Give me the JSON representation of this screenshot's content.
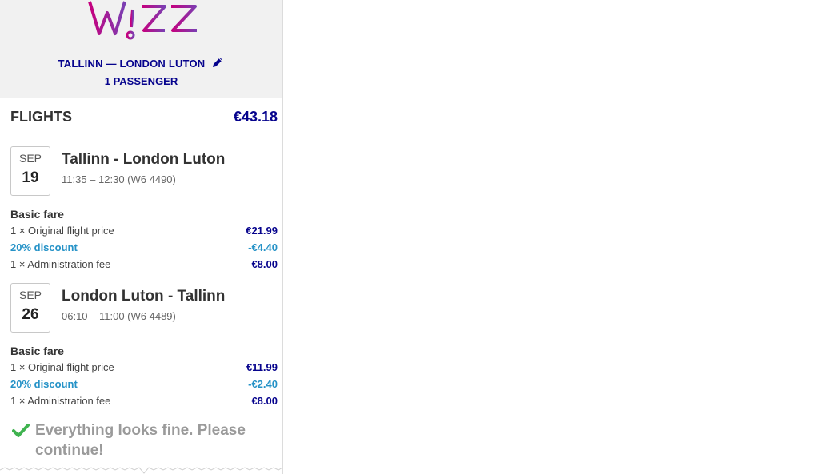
{
  "header": {
    "logo_text": "Wizz",
    "route": "TALLINN — LONDON LUTON",
    "passengers": "1 PASSENGER"
  },
  "summary": {
    "title": "FLIGHTS",
    "total": "€43.18"
  },
  "flights": [
    {
      "month": "SEP",
      "day": "19",
      "route": "Tallinn - London Luton",
      "time": "11:35 – 12:30 (W6 4490)",
      "fare_title": "Basic fare",
      "items": [
        {
          "label": "1 × Original flight price",
          "value": "€21.99"
        },
        {
          "label": "20% discount",
          "value": "-€4.40"
        },
        {
          "label": "1 × Administration fee",
          "value": "€8.00"
        }
      ]
    },
    {
      "month": "SEP",
      "day": "26",
      "route": "London Luton - Tallinn",
      "time": "06:10 – 11:00 (W6 4489)",
      "fare_title": "Basic fare",
      "items": [
        {
          "label": "1 × Original flight price",
          "value": "€11.99"
        },
        {
          "label": "20% discount",
          "value": "-€2.40"
        },
        {
          "label": "1 × Administration fee",
          "value": "€8.00"
        }
      ]
    }
  ],
  "status": {
    "message": "Everything looks fine. Please continue!"
  },
  "colors": {
    "brand_navy": "#06038d",
    "brand_magenta": "#c6007e",
    "discount_blue": "#2592c7",
    "success_green": "#3fb34f"
  },
  "icons": {
    "edit": "pencil-icon",
    "status": "checkmark-icon"
  }
}
